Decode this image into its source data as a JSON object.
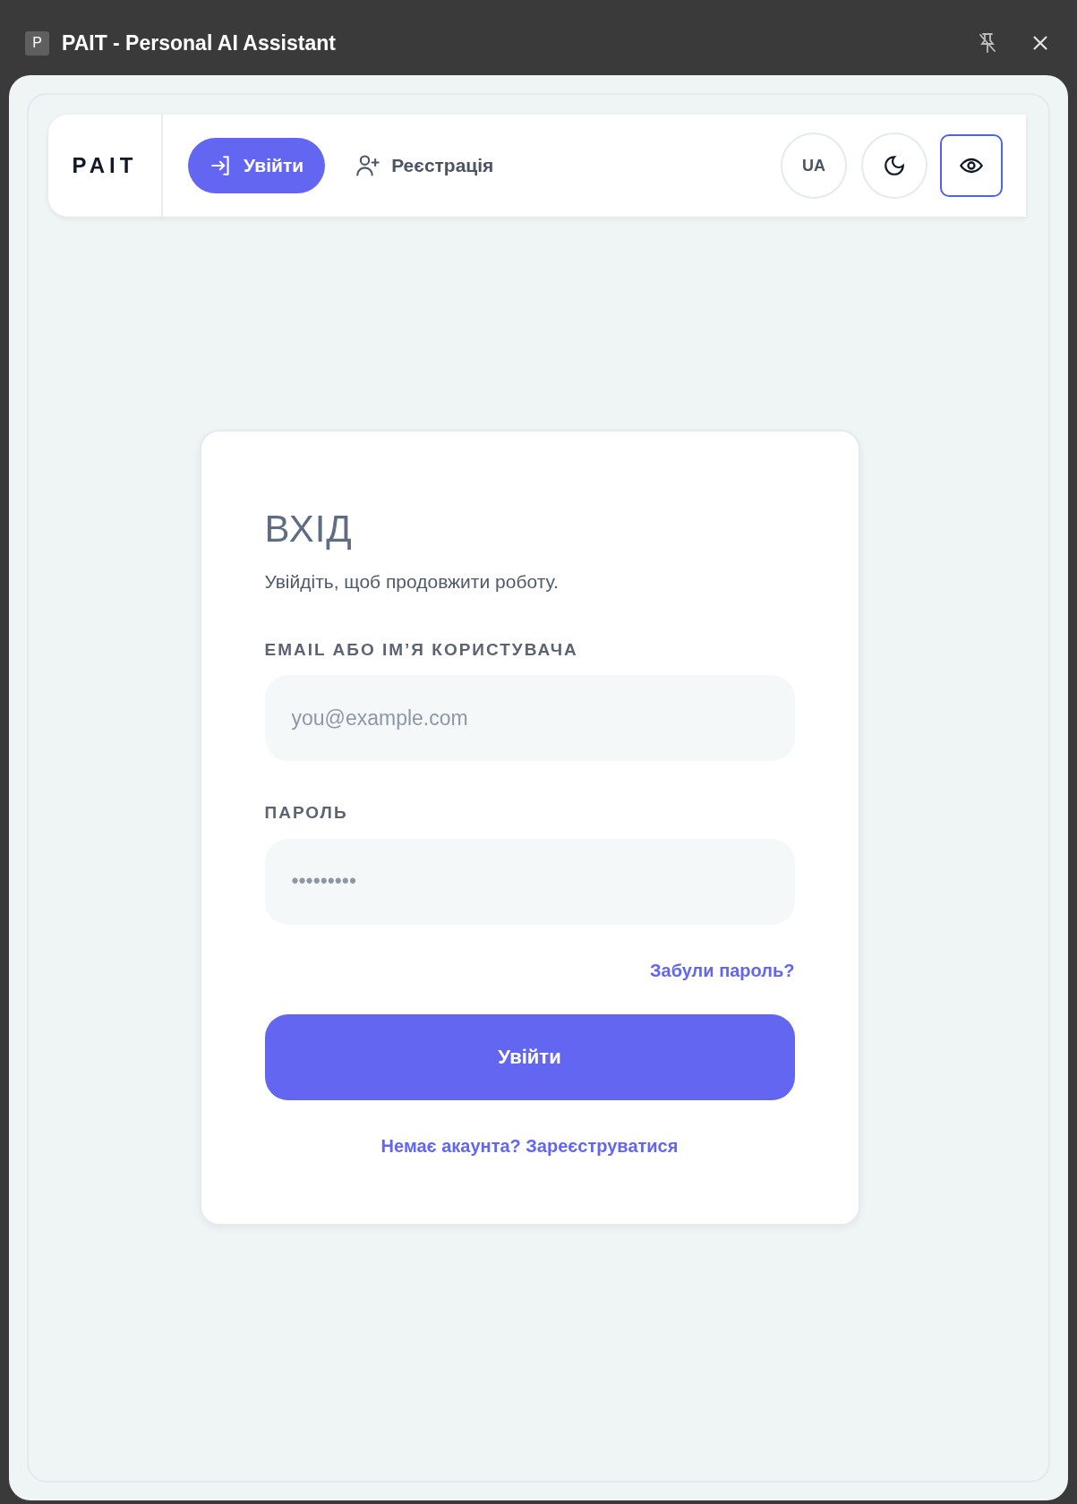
{
  "window": {
    "app_icon_letter": "P",
    "title": "PAIT - Personal AI Assistant",
    "pinned": false
  },
  "navbar": {
    "logo": "PAIT",
    "tabs": [
      {
        "label": "Увійти",
        "kind": "login",
        "selected": true
      },
      {
        "label": "Реєстрація",
        "kind": "register",
        "selected": false
      }
    ],
    "language": "UA",
    "accessibility_mode": true
  },
  "login_card": {
    "title": "ВХІД",
    "subtitle": "Увійдіть, щоб продовжити роботу.",
    "fields": [
      {
        "label": "EMAIL АБО ІМ’Я КОРИСТУВАЧА",
        "placeholder": "you@example.com"
      },
      {
        "label": "ПАРОЛЬ",
        "placeholder": "•••••••••"
      }
    ],
    "forgot_link": "Забули пароль?",
    "submit": "Увійти",
    "register_link": "Немає акаунта? Зареєструватися"
  }
}
